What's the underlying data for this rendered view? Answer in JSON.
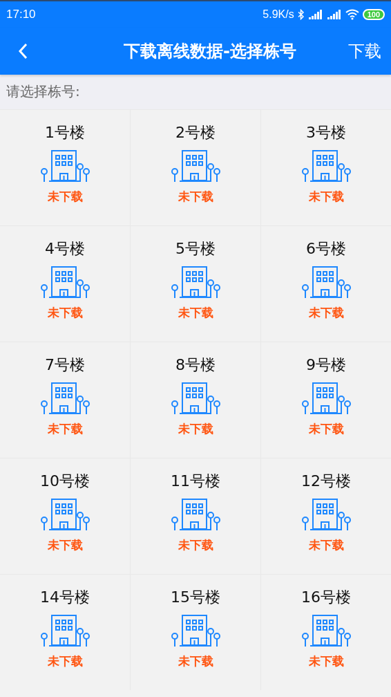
{
  "status_bar": {
    "time": "17:10",
    "speed": "5.9K/s",
    "battery": "100"
  },
  "app_bar": {
    "title": "下载离线数据-选择栋号",
    "action": "下载"
  },
  "prompt": "请选择栋号:",
  "buildings": [
    {
      "name": "1号楼",
      "status": "未下载"
    },
    {
      "name": "2号楼",
      "status": "未下载"
    },
    {
      "name": "3号楼",
      "status": "未下载"
    },
    {
      "name": "4号楼",
      "status": "未下载"
    },
    {
      "name": "5号楼",
      "status": "未下载"
    },
    {
      "name": "6号楼",
      "status": "未下载"
    },
    {
      "name": "7号楼",
      "status": "未下载"
    },
    {
      "name": "8号楼",
      "status": "未下载"
    },
    {
      "name": "9号楼",
      "status": "未下载"
    },
    {
      "name": "10号楼",
      "status": "未下载"
    },
    {
      "name": "11号楼",
      "status": "未下载"
    },
    {
      "name": "12号楼",
      "status": "未下载"
    },
    {
      "name": "14号楼",
      "status": "未下载"
    },
    {
      "name": "15号楼",
      "status": "未下载"
    },
    {
      "name": "16号楼",
      "status": "未下载"
    }
  ]
}
